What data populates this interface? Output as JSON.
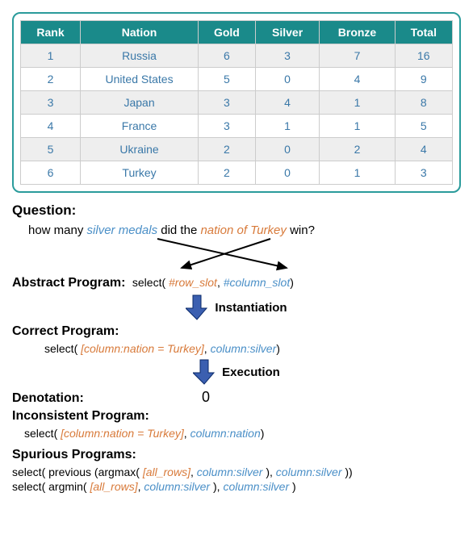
{
  "chart_data": {
    "type": "table",
    "headers": [
      "Rank",
      "Nation",
      "Gold",
      "Silver",
      "Bronze",
      "Total"
    ],
    "rows": [
      {
        "rank": "1",
        "nation": "Russia",
        "gold": "6",
        "silver": "3",
        "bronze": "7",
        "total": "16"
      },
      {
        "rank": "2",
        "nation": "United States",
        "gold": "5",
        "silver": "0",
        "bronze": "4",
        "total": "9"
      },
      {
        "rank": "3",
        "nation": "Japan",
        "gold": "3",
        "silver": "4",
        "bronze": "1",
        "total": "8"
      },
      {
        "rank": "4",
        "nation": "France",
        "gold": "3",
        "silver": "1",
        "bronze": "1",
        "total": "5"
      },
      {
        "rank": "5",
        "nation": "Ukraine",
        "gold": "2",
        "silver": "0",
        "bronze": "2",
        "total": "4"
      },
      {
        "rank": "6",
        "nation": "Turkey",
        "gold": "2",
        "silver": "0",
        "bronze": "1",
        "total": "3"
      }
    ]
  },
  "question": {
    "label": "Question:",
    "pre": "how many ",
    "silver": "silver medals",
    "mid": " did the ",
    "turkey": "nation of Turkey",
    "post": " win?"
  },
  "abstract": {
    "label": "Abstract Program:",
    "pre": "select( ",
    "row_slot": "#row_slot",
    "comma": ", ",
    "col_slot": "#column_slot",
    "close": ")"
  },
  "inst_label": "Instantiation",
  "correct": {
    "label": "Correct Program:",
    "pre": "select( ",
    "row": "[column:nation = Turkey]",
    "comma": ", ",
    "col": "column:silver",
    "close": ")"
  },
  "exec_label": "Execution",
  "denotation": {
    "label": "Denotation:",
    "value": "0"
  },
  "inconsistent": {
    "label": "Inconsistent Program:",
    "pre": "select( ",
    "row": "[column:nation = Turkey]",
    "comma": ", ",
    "col": "column:nation",
    "close": ")"
  },
  "spurious": {
    "label": "Spurious Programs:",
    "line1": {
      "t1": "select( previous (argmax( ",
      "all": "[all_rows]",
      "t2": ", ",
      "c1": "column:silver",
      "t3": " ), ",
      "c2": "column:silver",
      "t4": " ))"
    },
    "line2": {
      "t1": "select( argmin( ",
      "all": "[all_rows]",
      "t2": ", ",
      "c1": "column:silver",
      "t3": " ), ",
      "c2": "column:silver",
      "t4": " )"
    }
  }
}
